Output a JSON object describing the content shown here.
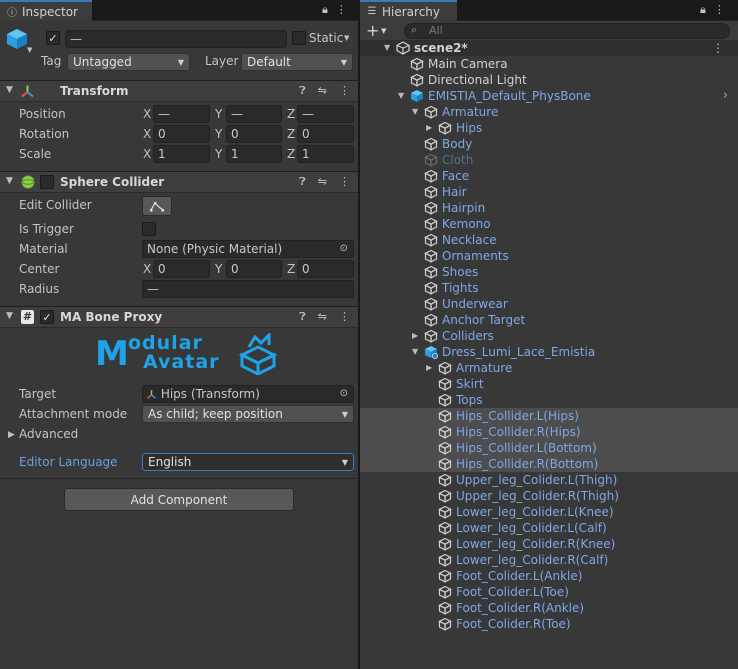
{
  "inspector": {
    "tab_title": "Inspector",
    "gameobject": {
      "name": "—",
      "static_label": "Static",
      "tag_label": "Tag",
      "tag_value": "Untagged",
      "layer_label": "Layer",
      "layer_value": "Default"
    },
    "transform": {
      "title": "Transform",
      "position_label": "Position",
      "rotation_label": "Rotation",
      "scale_label": "Scale",
      "axis_x": "X",
      "axis_y": "Y",
      "axis_z": "Z",
      "position": [
        "—",
        "—",
        "—"
      ],
      "rotation": [
        "0",
        "0",
        "0"
      ],
      "scale": [
        "1",
        "1",
        "1"
      ]
    },
    "sphere_collider": {
      "title": "Sphere Collider",
      "edit_collider_label": "Edit Collider",
      "is_trigger_label": "Is Trigger",
      "material_label": "Material",
      "material_value": "None (Physic Material)",
      "center_label": "Center",
      "center": [
        "0",
        "0",
        "0"
      ],
      "radius_label": "Radius",
      "radius_value": "—"
    },
    "bone_proxy": {
      "title": "MA Bone Proxy",
      "logo_line1": "odular",
      "logo_line2": "Avatar",
      "logo_letter": "M",
      "target_label": "Target",
      "target_value": "Hips (Transform)",
      "attachment_label": "Attachment mode",
      "attachment_value": "As child; keep position",
      "advanced_label": "Advanced",
      "editor_language_label": "Editor Language",
      "editor_language_value": "English"
    },
    "add_component_label": "Add Component"
  },
  "hierarchy": {
    "tab_title": "Hierarchy",
    "search_placeholder": "All",
    "rows": [
      {
        "name": "scene2*"
      },
      {
        "name": "Main Camera"
      },
      {
        "name": "Directional Light"
      },
      {
        "name": "EMISTIA_Default_PhysBone"
      },
      {
        "name": "Armature"
      },
      {
        "name": "Hips"
      },
      {
        "name": "Body"
      },
      {
        "name": "Cloth"
      },
      {
        "name": "Face"
      },
      {
        "name": "Hair"
      },
      {
        "name": "Hairpin"
      },
      {
        "name": "Kemono"
      },
      {
        "name": "Necklace"
      },
      {
        "name": "Ornaments"
      },
      {
        "name": "Shoes"
      },
      {
        "name": "Tights"
      },
      {
        "name": "Underwear"
      },
      {
        "name": "Anchor Target"
      },
      {
        "name": "Colliders"
      },
      {
        "name": "Dress_Lumi_Lace_Emistia"
      },
      {
        "name": "Armature"
      },
      {
        "name": "Skirt"
      },
      {
        "name": "Tops"
      },
      {
        "name": "Hips_Collider.L(Hips)"
      },
      {
        "name": "Hips_Collider.R(Hips)"
      },
      {
        "name": "Hips_Collider.L(Bottom)"
      },
      {
        "name": "Hips_Collider.R(Bottom)"
      },
      {
        "name": "Upper_leg_Colider.L(Thigh)"
      },
      {
        "name": "Upper_leg_Colider.R(Thigh)"
      },
      {
        "name": "Lower_leg_Colider.L(Knee)"
      },
      {
        "name": "Lower_leg_Colider.L(Calf)"
      },
      {
        "name": "Lower_leg_Colider.R(Knee)"
      },
      {
        "name": "Lower_leg_Colider.R(Calf)"
      },
      {
        "name": "Foot_Colider.L(Ankle)"
      },
      {
        "name": "Foot_Colider.L(Toe)"
      },
      {
        "name": "Foot_Colider.R(Ankle)"
      },
      {
        "name": "Foot_Colider.R(Toe)"
      }
    ]
  },
  "colors": {
    "accent": "#3a79bb",
    "prefab_text": "#7ea8e6",
    "panel_bg": "#383838",
    "selected_row": "#4d4d4d",
    "logo_blue": "#1fa3e8"
  }
}
